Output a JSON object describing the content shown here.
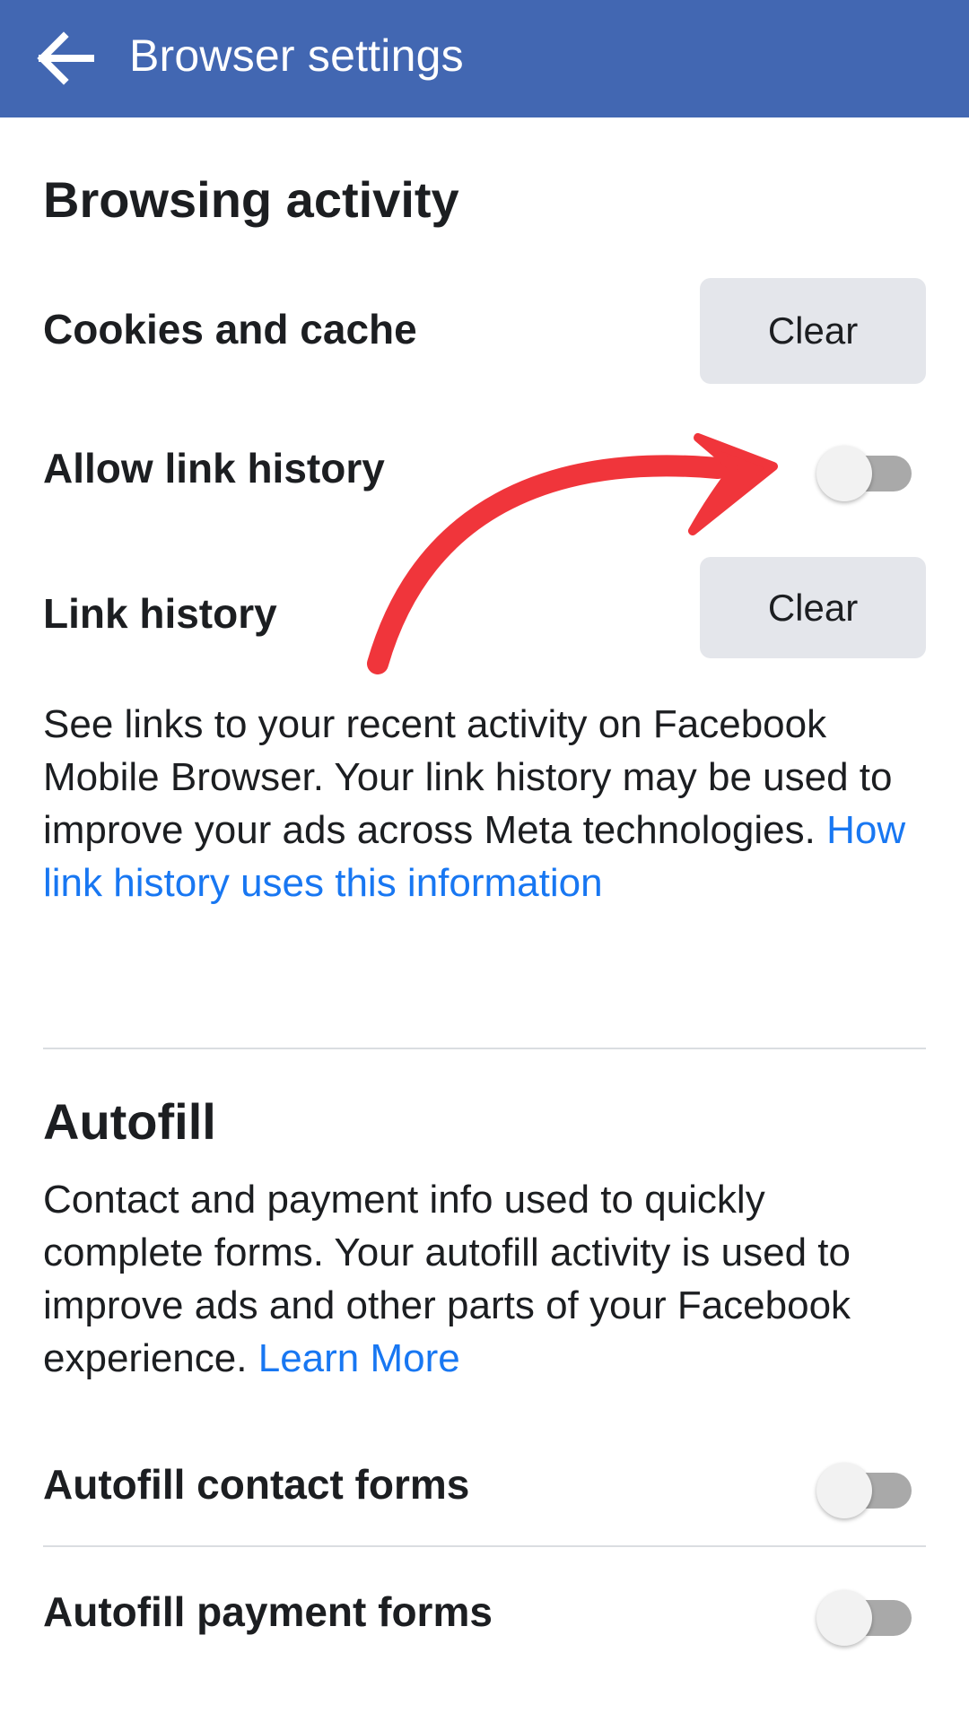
{
  "header": {
    "title": "Browser settings"
  },
  "browsing_activity": {
    "title": "Browsing activity",
    "cookies_label": "Cookies and cache",
    "cookies_button": "Clear",
    "allow_link_history_label": "Allow link history",
    "allow_link_history_on": false,
    "link_history_label": "Link history",
    "link_history_button": "Clear",
    "description": "See links to your recent activity on Facebook Mobile Browser. Your link history may be used to improve your ads across Meta technologies.",
    "description_link": "How link history uses this information"
  },
  "autofill": {
    "title": "Autofill",
    "description": "Contact and payment info used to quickly complete forms. Your autofill activity is used to improve ads and other parts of your Facebook experience.",
    "description_link": "Learn More",
    "contact_forms_label": "Autofill contact forms",
    "contact_forms_on": false,
    "payment_forms_label": "Autofill payment forms",
    "payment_forms_on": false
  },
  "colors": {
    "header_bg": "#4267b2",
    "link": "#1877f2",
    "button_bg": "#e4e6eb",
    "annotation_arrow": "#f0353b"
  },
  "icons": {
    "back": "back-arrow-icon",
    "annotation": "red-annotation-arrow"
  }
}
